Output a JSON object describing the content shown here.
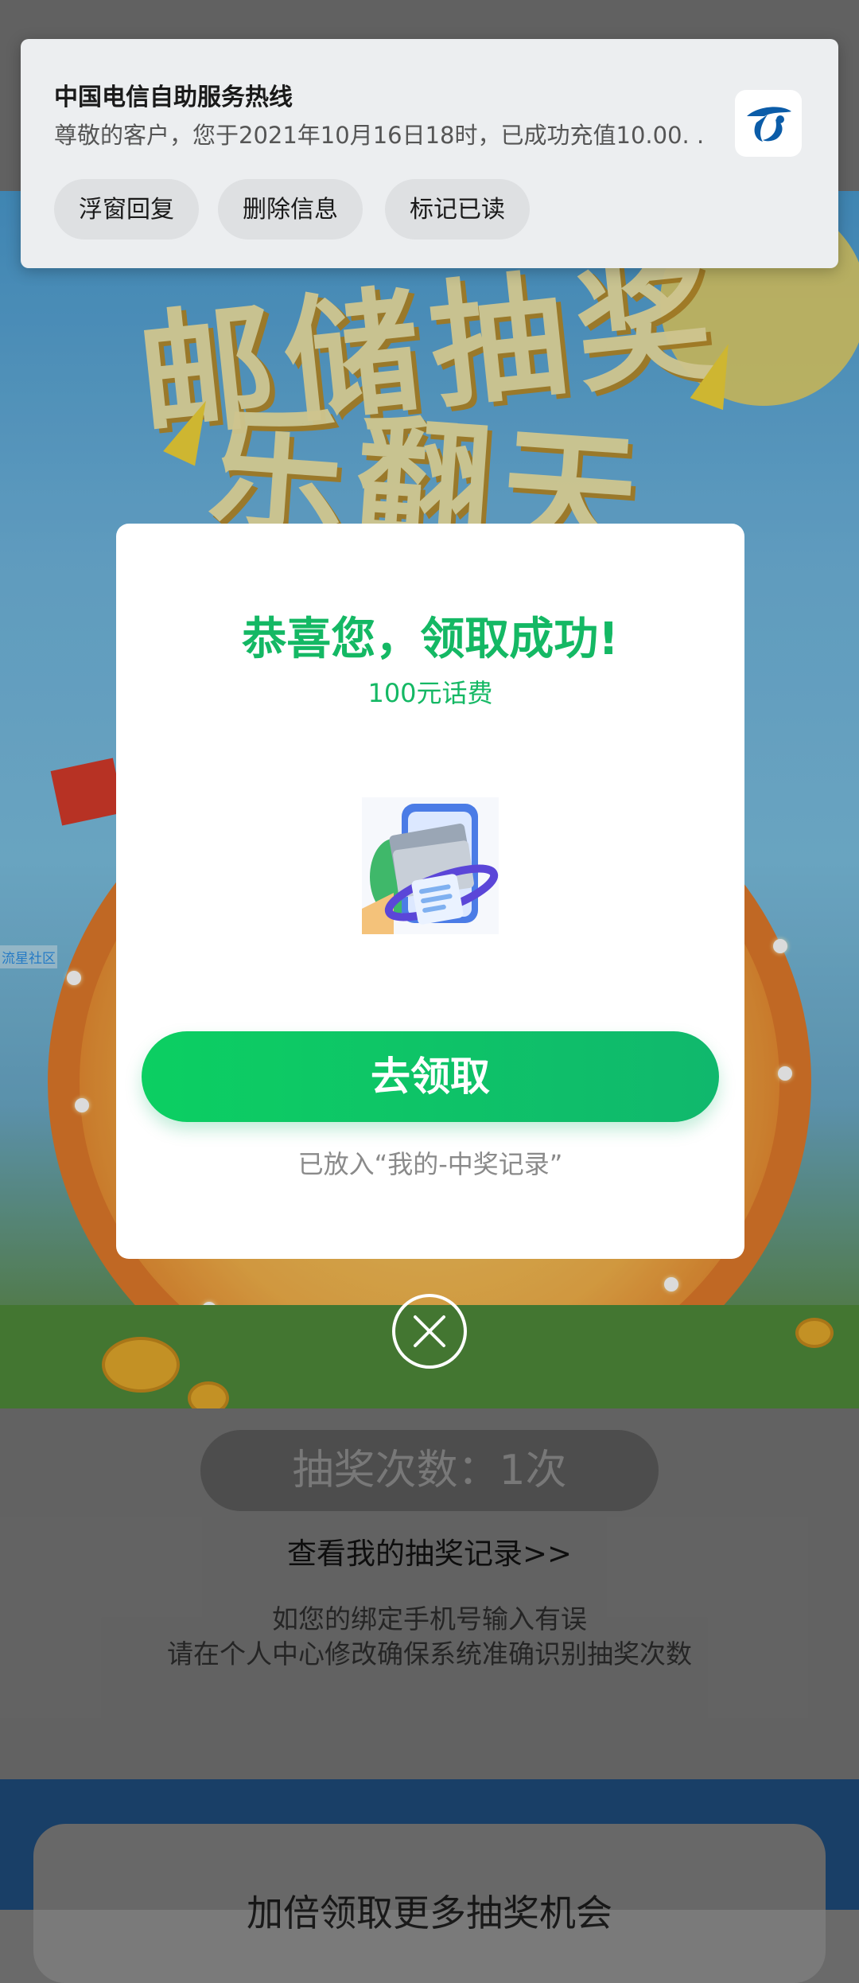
{
  "notification": {
    "title": "中国电信自助服务热线",
    "body": "尊敬的客户，您于2021年10月16日18时，已成功充值10.00. .",
    "logo_icon": "china-telecom-logo",
    "buttons": [
      "浮窗回复",
      "删除信息",
      "标记已读"
    ]
  },
  "background": {
    "side_link": "流星社区",
    "draw_count": "抽奖次数：1次",
    "records_link": "查看我的抽奖记录>>",
    "hint_line1": "如您的绑定手机号输入有误",
    "hint_line2": "请在个人中心修改确保系统准确识别抽奖次数",
    "bottom_card_title": "加倍领取更多抽奖机会"
  },
  "modal": {
    "title": "恭喜您，领取成功!",
    "subtitle": "100元话费",
    "prize_icon": "phone-card-prize-icon",
    "claim_button": "去领取",
    "note": "已放入“我的-中奖记录”",
    "close_icon": "close-icon"
  },
  "colors": {
    "accent_green": "#14b864",
    "button_green": "#0ccf62",
    "telecom_blue": "#0b5ca8"
  }
}
